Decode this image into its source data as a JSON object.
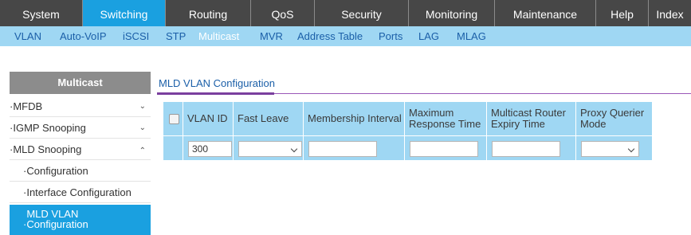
{
  "topnav": {
    "tabs": [
      {
        "label": "System"
      },
      {
        "label": "Switching"
      },
      {
        "label": "Routing"
      },
      {
        "label": "QoS"
      },
      {
        "label": "Security"
      },
      {
        "label": "Monitoring"
      },
      {
        "label": "Maintenance"
      },
      {
        "label": "Help"
      },
      {
        "label": "Index"
      }
    ],
    "active": "Switching"
  },
  "subnav": {
    "items": [
      {
        "label": "VLAN"
      },
      {
        "label": "Auto-VoIP"
      },
      {
        "label": "iSCSI"
      },
      {
        "label": "STP"
      },
      {
        "label": "Multicast"
      },
      {
        "label": "MVR"
      },
      {
        "label": "Address Table"
      },
      {
        "label": "Ports"
      },
      {
        "label": "LAG"
      },
      {
        "label": "MLAG"
      }
    ],
    "active": "Multicast"
  },
  "sidebar": {
    "title": "Multicast",
    "items": [
      {
        "label": "MFDB"
      },
      {
        "label": "IGMP Snooping"
      },
      {
        "label": "MLD Snooping"
      },
      {
        "label": "Configuration"
      },
      {
        "label": "Interface Configuration"
      },
      {
        "label": "MLD VLAN Configuration"
      }
    ]
  },
  "main": {
    "title": "MLD VLAN Configuration",
    "table": {
      "columns": [
        "VLAN ID",
        "Fast Leave",
        "Membership Interval",
        "Maximum Response Time",
        "Multicast Router Expiry Time",
        "Proxy Querier Mode"
      ],
      "row": {
        "vlan_id": "300",
        "fast_leave": "",
        "membership_interval": "",
        "max_response_time": "",
        "router_expiry_time": "",
        "proxy_querier_mode": ""
      }
    }
  },
  "colors": {
    "nav_bg": "#474747",
    "nav_active": "#1aa0e0",
    "subnav_bg": "#9fd7f3",
    "table_bg": "#9fd7f3",
    "accent_purple": "#7a3f9e"
  }
}
